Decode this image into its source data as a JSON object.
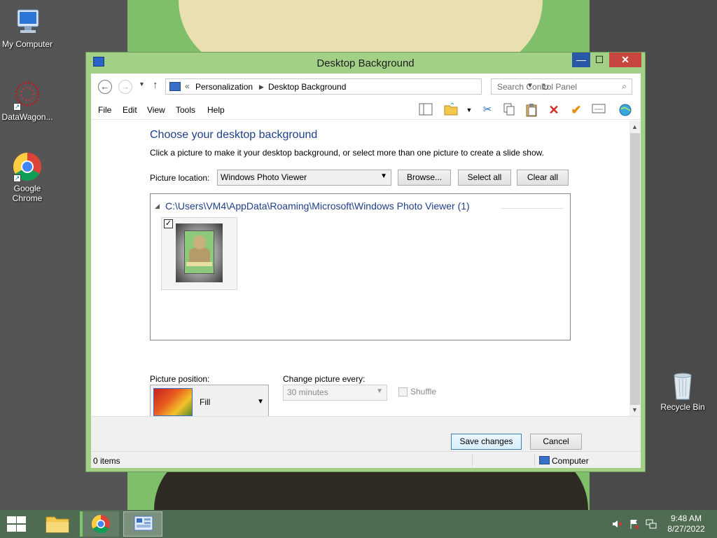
{
  "desktop": {
    "icons": [
      {
        "label": "My Computer"
      },
      {
        "label": "DataWagon..."
      },
      {
        "label": "Google Chrome"
      },
      {
        "label": "Recycle Bin"
      }
    ]
  },
  "window": {
    "title": "Desktop Background",
    "controls": {
      "minimize": "—",
      "maximize": "☐",
      "close": "✕"
    }
  },
  "address_bar": {
    "prefix": "«",
    "crumbs": [
      "Personalization",
      "Desktop Background"
    ]
  },
  "search": {
    "placeholder": "Search Control Panel"
  },
  "menu": [
    "File",
    "Edit",
    "View",
    "Tools",
    "Help"
  ],
  "content": {
    "heading": "Choose your desktop background",
    "subheading": "Click a picture to make it your desktop background, or select more than one picture to create a slide show.",
    "picture_location_label": "Picture location:",
    "picture_location_value": "Windows Photo Viewer",
    "buttons": {
      "browse": "Browse...",
      "select_all": "Select all",
      "clear_all": "Clear all"
    },
    "folder_path": "C:\\Users\\VM4\\AppData\\Roaming\\Microsoft\\Windows Photo Viewer (1)",
    "thumbnail_checked": true,
    "picture_position_label": "Picture position:",
    "picture_position_value": "Fill",
    "change_every_label": "Change picture every:",
    "change_every_value": "30 minutes",
    "shuffle_label": "Shuffle",
    "shuffle_checked": false
  },
  "footer": {
    "save": "Save changes",
    "cancel": "Cancel"
  },
  "statusbar": {
    "items": "0 items",
    "location": "Computer"
  },
  "taskbar": {
    "time": "9:48 AM",
    "date": "8/27/2022"
  },
  "colors": {
    "window_frame": "#a3d087",
    "heading": "#1e3f8a",
    "close_button": "#c7463f",
    "minimize_button": "#2a58a8",
    "taskbar": "#4f6b52"
  }
}
